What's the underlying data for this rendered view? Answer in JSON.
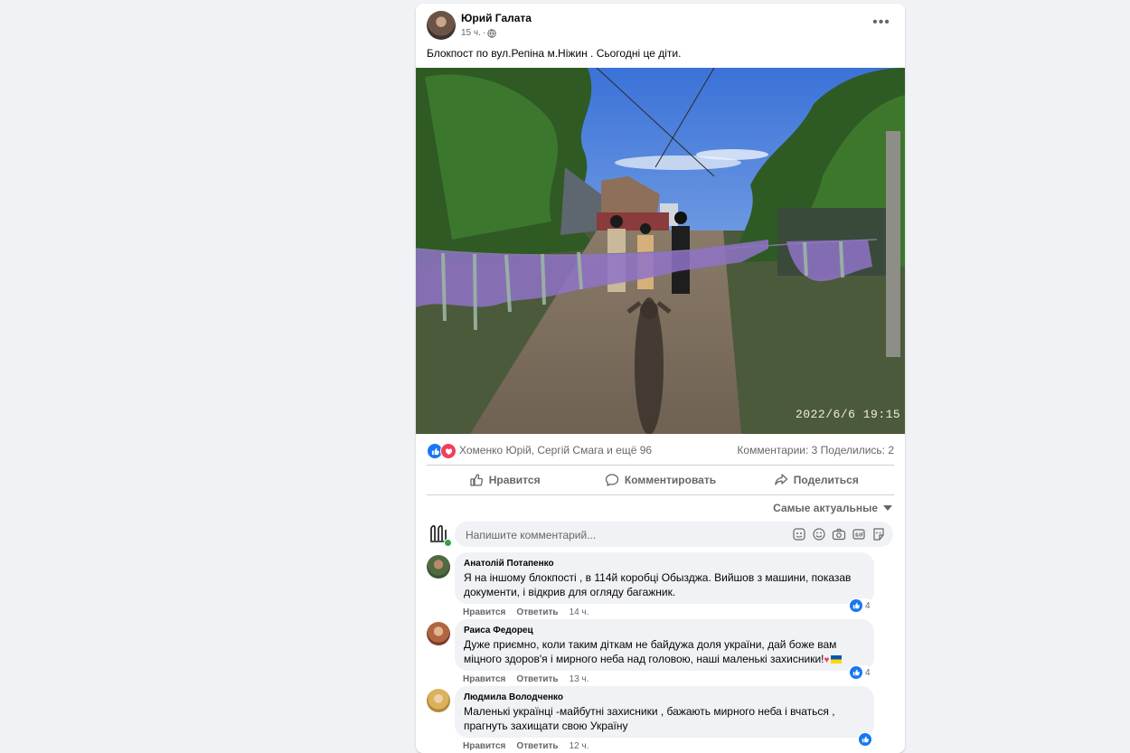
{
  "post": {
    "author": "Юрий Галата",
    "time": "15 ч.",
    "separator": "·",
    "text": "Блокпост по вул.Репіна м.Ніжин . Сьогодні це діти.",
    "photo_timestamp": "2022/6/6 19:15",
    "reactions": {
      "names": "Хоменко Юрій, Сергій Смага и ещё 96",
      "comments": "Комментарии: 3",
      "shares": "Поделились: 2"
    },
    "actions": {
      "like": "Нравится",
      "comment": "Комментировать",
      "share": "Поделиться"
    },
    "sort_label": "Самые актуальные",
    "comment_placeholder": "Напишите комментарий..."
  },
  "comments": [
    {
      "name": "Анатолій Потапенко",
      "text": "Я на іншому блокпості , в 114й коробці Обызджа. Вийшов з машини, показав документи, і відкрив для огляду багажник.",
      "like": "Нравится",
      "reply": "Ответить",
      "time": "14 ч.",
      "reactions": "4"
    },
    {
      "name": "Раиса Федорец",
      "text": "Дуже приємно, коли таким діткам не байдужа доля україни, дай боже вам міцного здоров'я і мирного неба над головою, наші маленькі захисники!",
      "like": "Нравится",
      "reply": "Ответить",
      "time": "13 ч.",
      "reactions": "4"
    },
    {
      "name": "Людмила Володченко",
      "text": "Маленькі українці -майбутні захисники , бажають мирного неба і вчаться , прагнуть захищати свою Україну",
      "like": "Нравится",
      "reply": "Ответить",
      "time": "12 ч.",
      "reactions": ""
    }
  ],
  "colors": {
    "background": "#f0f2f5",
    "primary_text": "#050505",
    "secondary_text": "#65676b",
    "like_blue": "#1877f2",
    "love_red": "#f33e58",
    "online_green": "#31a24c"
  },
  "icons": [
    "globe-icon",
    "more-options-icon",
    "like-reaction-icon",
    "love-reaction-icon",
    "thumbs-up-icon",
    "comment-icon",
    "share-icon",
    "sort-dropdown-icon",
    "avatar-icon",
    "sticker-icon",
    "emoji-icon",
    "camera-icon",
    "gif-icon",
    "avatar-sticker-icon"
  ]
}
